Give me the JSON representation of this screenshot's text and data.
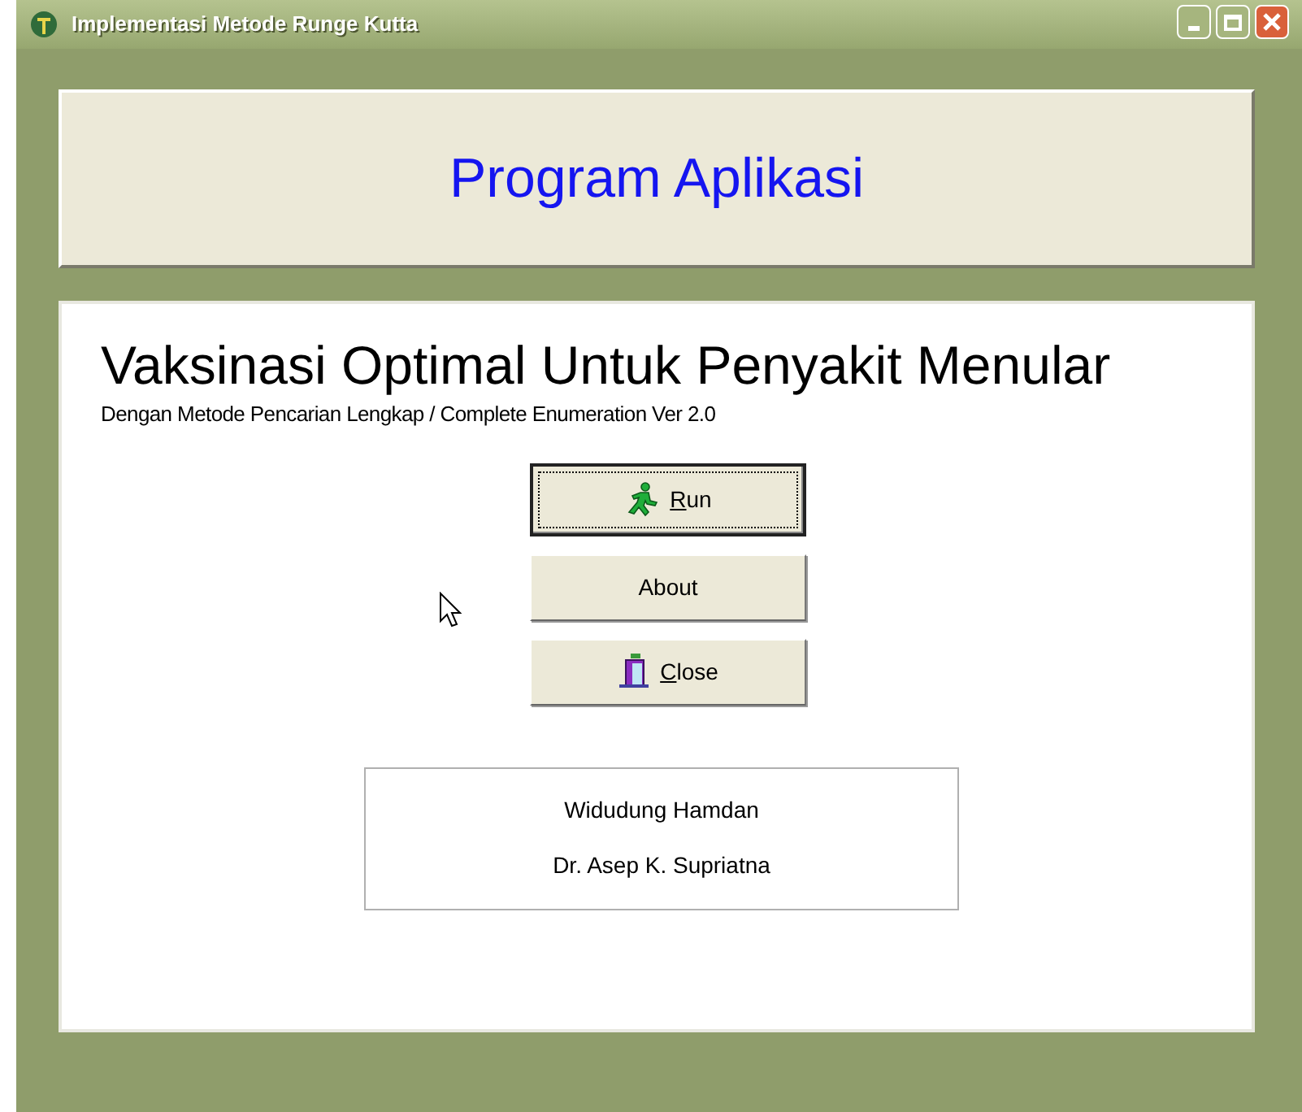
{
  "window": {
    "title": "Implementasi Metode Runge Kutta"
  },
  "header": {
    "title": "Program Aplikasi"
  },
  "main": {
    "heading": "Vaksinasi Optimal Untuk Penyakit Menular",
    "subtitle": "Dengan Metode Pencarian Lengkap / Complete Enumeration Ver 2.0"
  },
  "buttons": [
    {
      "label": "Run",
      "kind": "runner",
      "focused": true,
      "mnemonic_underlined": true
    },
    {
      "label": "About",
      "kind": "plain",
      "focused": false,
      "mnemonic_underlined": false
    },
    {
      "label": "Close",
      "kind": "door",
      "focused": false,
      "mnemonic_underlined": true
    }
  ],
  "credits": [
    "Widudung Hamdan",
    "Dr. Asep K. Supriatna"
  ]
}
